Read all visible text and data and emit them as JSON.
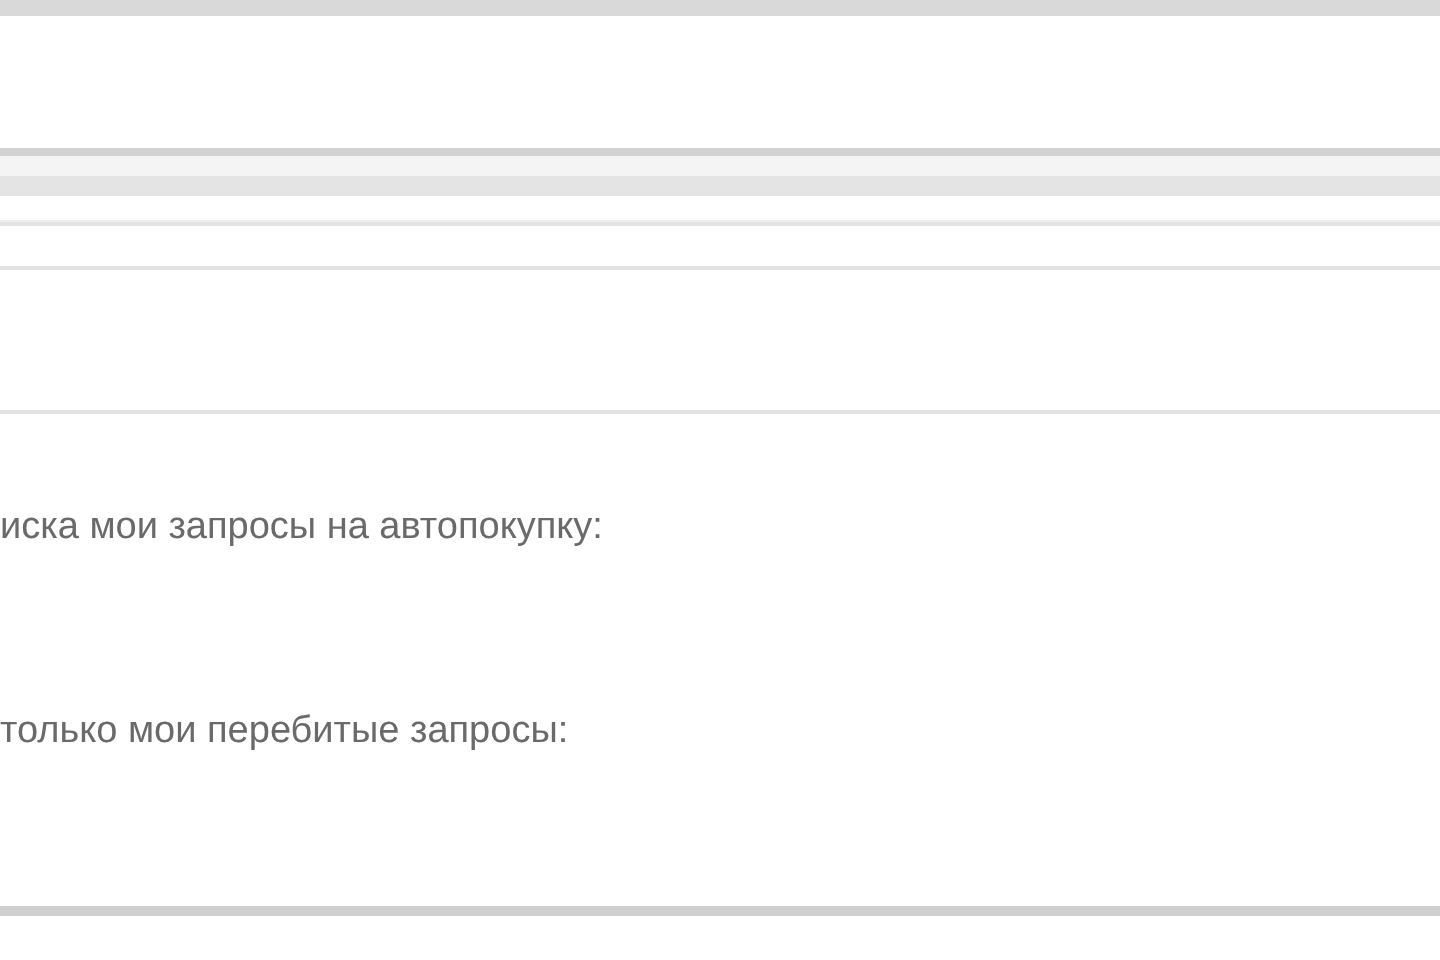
{
  "lines": [
    "иска мои запросы на автопокупку:",
    "только мои перебитые запросы:"
  ]
}
